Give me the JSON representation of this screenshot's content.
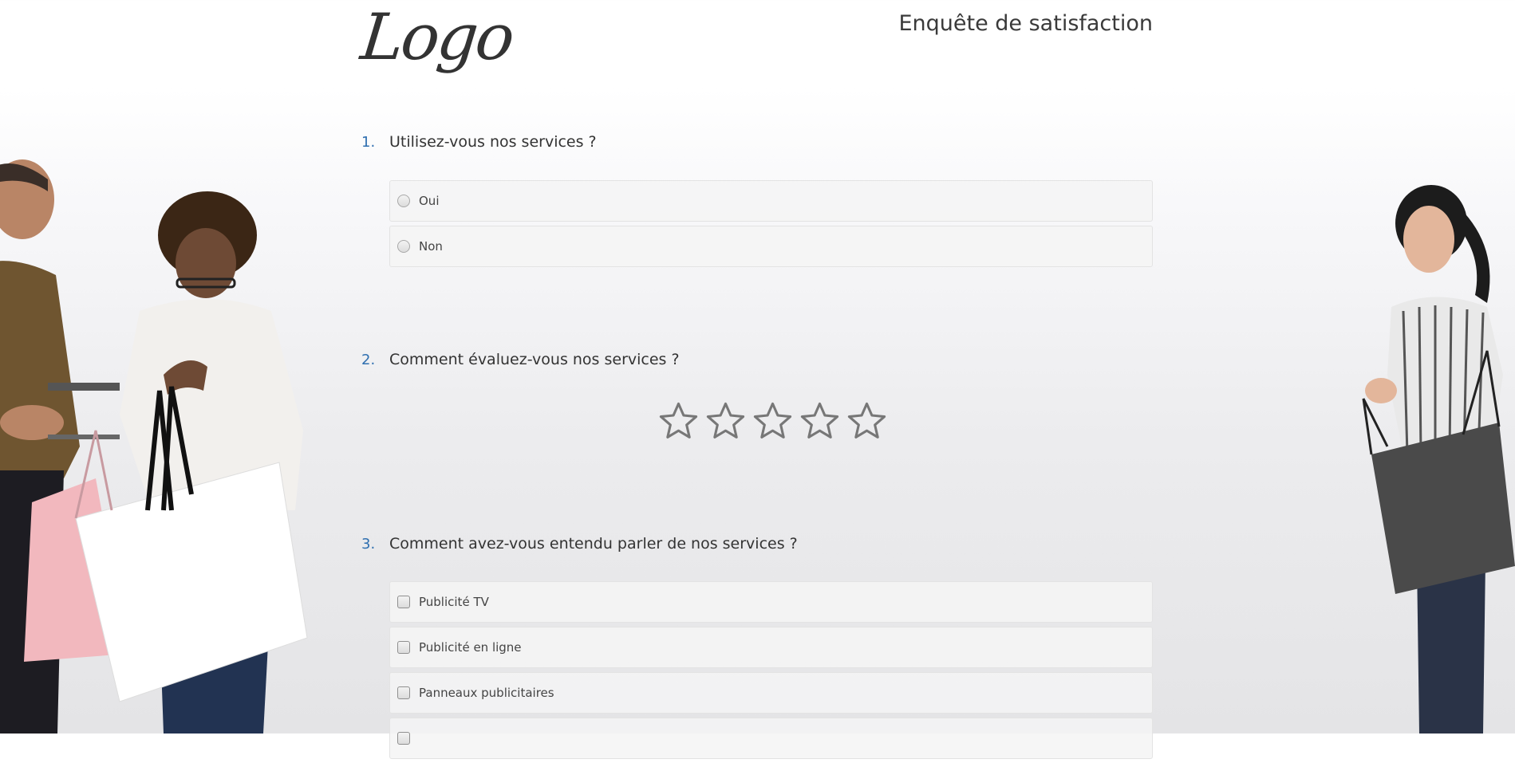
{
  "header": {
    "logo_text": "Logo",
    "title": "Enquête de satisfaction"
  },
  "questions": [
    {
      "number": "1.",
      "text": "Utilisez-vous nos services ?",
      "type": "radio",
      "options": [
        "Oui",
        "Non"
      ]
    },
    {
      "number": "2.",
      "text": "Comment évaluez-vous nos services ?",
      "type": "star-rating",
      "max_stars": 5,
      "selected_stars": 0
    },
    {
      "number": "3.",
      "text": "Comment avez-vous entendu parler de nos services ?",
      "type": "checkbox",
      "options": [
        "Publicité TV",
        "Publicité en ligne",
        "Panneaux publicitaires"
      ]
    }
  ],
  "colors": {
    "question_number": "#2f6fb0",
    "text": "#333333",
    "option_bg": "#f5f5f5",
    "option_border": "#e3e3e3",
    "star_outline": "#777777"
  },
  "icons": {
    "rating": "star-outline-icon",
    "single_choice": "radio-button",
    "multi_choice": "checkbox"
  }
}
